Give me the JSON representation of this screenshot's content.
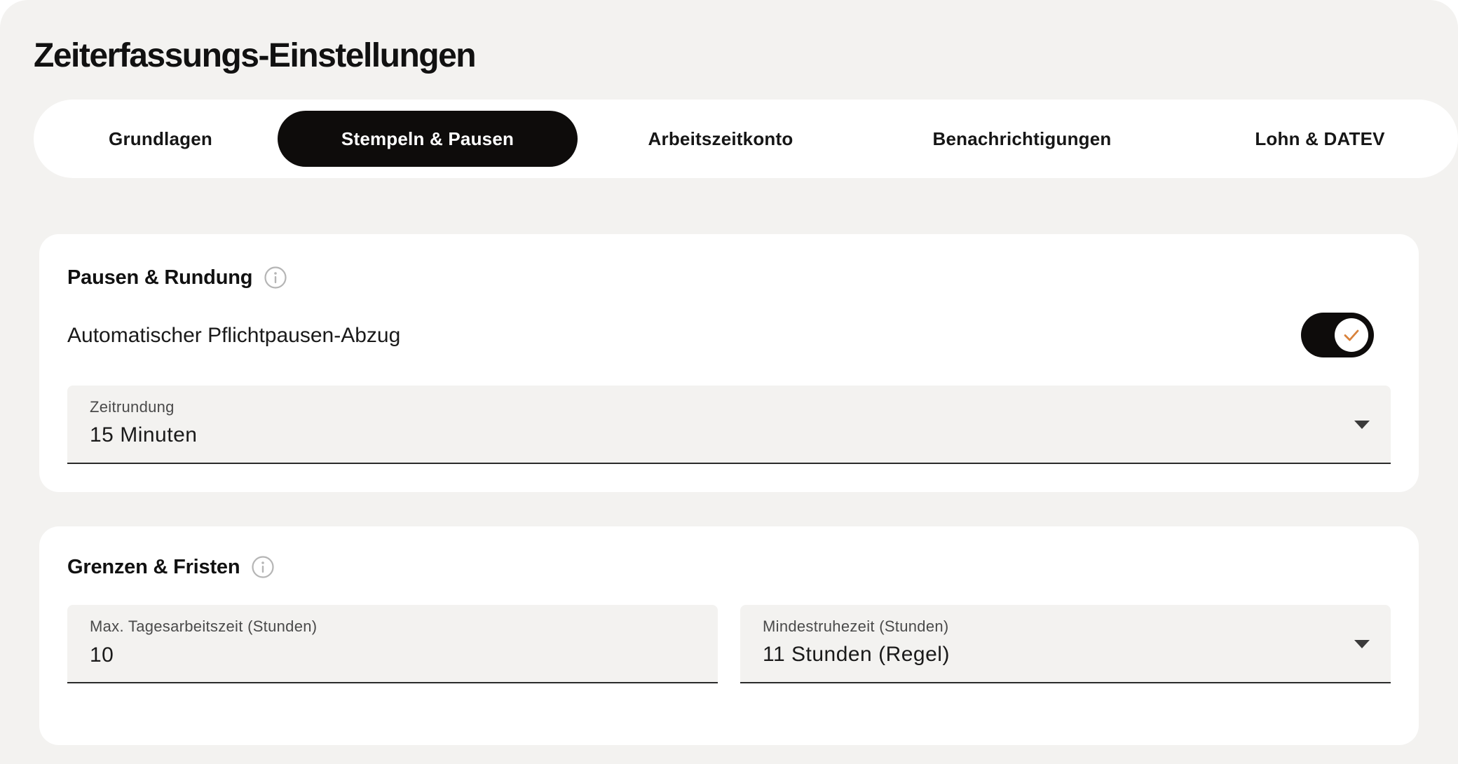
{
  "page": {
    "title": "Zeiterfassungs-Einstellungen"
  },
  "tabs": [
    {
      "label": "Grundlagen",
      "active": false
    },
    {
      "label": "Stempeln & Pausen",
      "active": true
    },
    {
      "label": "Arbeitszeitkonto",
      "active": false
    },
    {
      "label": "Benachrichtigungen",
      "active": false
    },
    {
      "label": "Lohn & DATEV",
      "active": false
    }
  ],
  "sections": {
    "pausen": {
      "title": "Pausen & Rundung",
      "icon": "info-icon",
      "auto_break": {
        "label": "Automatischer Pflichtpausen-Abzug",
        "enabled": true,
        "icon": "check-icon"
      },
      "rounding": {
        "label": "Zeitrundung",
        "value": "15 Minuten",
        "icon": "chevron-down-icon"
      }
    },
    "grenzen": {
      "title": "Grenzen & Fristen",
      "icon": "info-icon",
      "max_daily": {
        "label": "Max. Tagesarbeitszeit (Stunden)",
        "value": "10"
      },
      "min_rest": {
        "label": "Mindestruhezeit (Stunden)",
        "value": "11 Stunden (Regel)",
        "icon": "chevron-down-icon"
      }
    }
  },
  "colors": {
    "background": "#f3f2f0",
    "card": "#ffffff",
    "active_tab": "#0e0c0b",
    "check_accent": "#d9823b",
    "info_icon": "#b5b5b5"
  }
}
